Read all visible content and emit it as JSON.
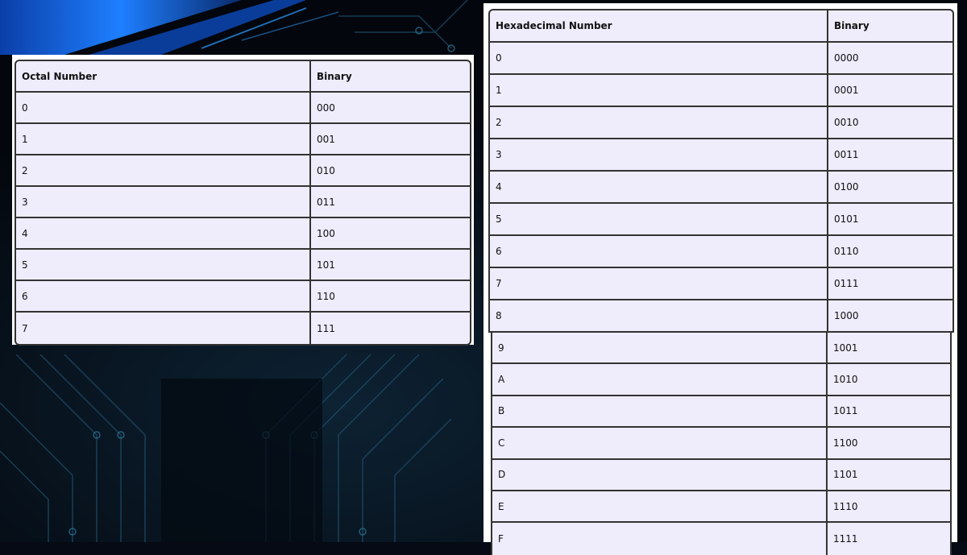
{
  "octal_table": {
    "headers": [
      "Octal Number",
      "Binary"
    ],
    "rows": [
      [
        "0",
        "000"
      ],
      [
        "1",
        "001"
      ],
      [
        "2",
        "010"
      ],
      [
        "3",
        "011"
      ],
      [
        "4",
        "100"
      ],
      [
        "5",
        "101"
      ],
      [
        "6",
        "110"
      ],
      [
        "7",
        "111"
      ]
    ]
  },
  "hex_table": {
    "headers": [
      "Hexadecimal Number",
      "Binary"
    ],
    "rows": [
      [
        "0",
        "0000"
      ],
      [
        "1",
        "0001"
      ],
      [
        "2",
        "0010"
      ],
      [
        "3",
        "0011"
      ],
      [
        "4",
        "0100"
      ],
      [
        "5",
        "0101"
      ],
      [
        "6",
        "0110"
      ],
      [
        "7",
        "0111"
      ],
      [
        "8",
        "1000"
      ],
      [
        "9",
        "1001"
      ],
      [
        "A",
        "1010"
      ],
      [
        "B",
        "1011"
      ],
      [
        "C",
        "1100"
      ],
      [
        "D",
        "1101"
      ],
      [
        "E",
        "1110"
      ],
      [
        "F",
        "1111"
      ]
    ]
  },
  "colors": {
    "background": "#050a14",
    "accent": "#1e7fff",
    "table_fill": "#efecfc",
    "table_border": "#333333"
  }
}
